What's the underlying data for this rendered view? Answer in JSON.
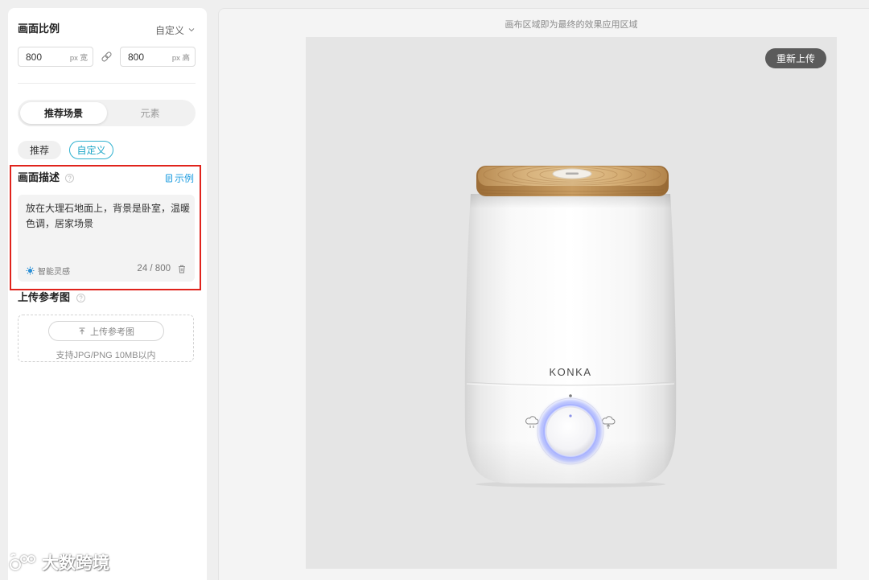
{
  "canvas": {
    "hint": "画布区域即为最终的效果应用区域",
    "reupload_label": "重新上传"
  },
  "sidebar": {
    "ratio": {
      "title": "画面比例",
      "mode": "自定义",
      "width": {
        "value": "800",
        "unit": "px 宽"
      },
      "height": {
        "value": "800",
        "unit": "px 高"
      }
    },
    "tabs": [
      {
        "label": "推荐场景",
        "active": true
      },
      {
        "label": "元素",
        "active": false
      }
    ],
    "chips": [
      {
        "label": "推荐",
        "active": false
      },
      {
        "label": "自定义",
        "active": true
      }
    ],
    "description": {
      "title": "画面描述",
      "example_label": "示例",
      "text": "放在大理石地面上，背景是卧室，温暖色调，居家场景",
      "inspiration_label": "智能灵感",
      "counter": "24 / 800"
    },
    "reference": {
      "title": "上传参考图",
      "button_label": "上传参考图",
      "hint": "支持JPG/PNG 10MB以内"
    }
  },
  "product": {
    "brand": "KONKA"
  },
  "watermark": {
    "text": "大数跨境"
  },
  "icons": [
    "chevron-down-icon",
    "link-icon",
    "help-icon",
    "example-doc-icon",
    "inspiration-icon",
    "trash-icon",
    "upload-icon",
    "watermark-logo-icon"
  ],
  "colors": {
    "accent": "#1e9de0",
    "chip_active": "#1ba5c7",
    "highlight_border": "#e0231c",
    "reupload_bg": "#5b5b5b",
    "canvas_bg": "#e5e5e5",
    "wood": "#d7b27c",
    "knob_glow": "#7c8cff"
  }
}
